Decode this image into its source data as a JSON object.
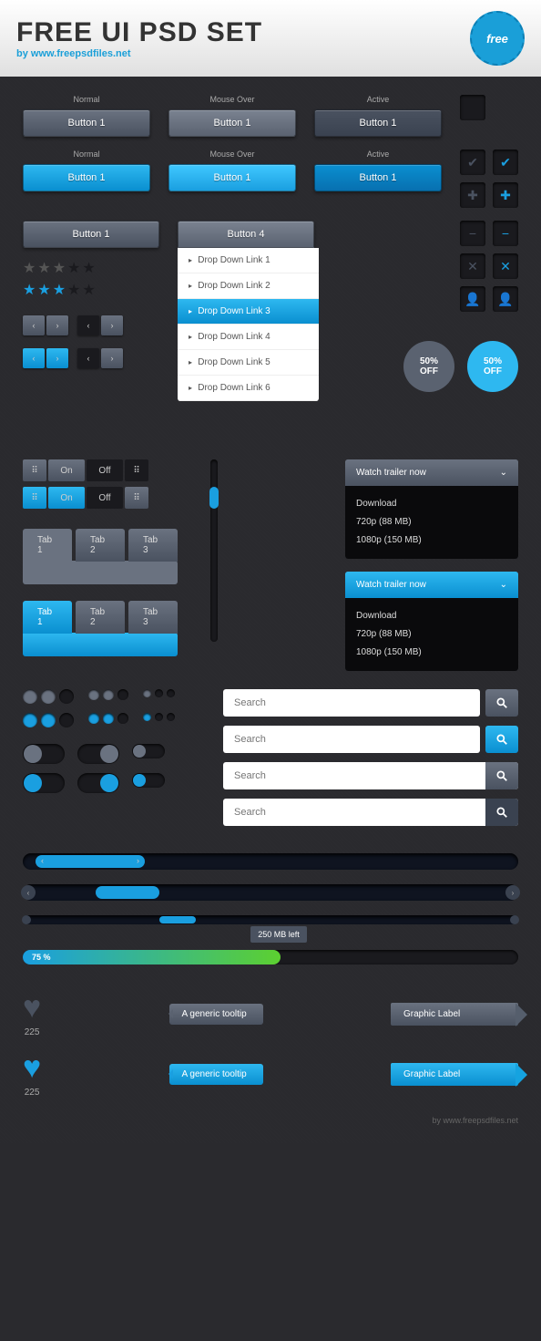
{
  "header": {
    "title": "FREE UI PSD SET",
    "byline": "by www.freepsdfiles.net",
    "badge": "free"
  },
  "states": {
    "normal": "Normal",
    "hover": "Mouse Over",
    "active": "Active"
  },
  "buttons": {
    "gray": "Button 1",
    "blue": "Button 1",
    "wide1": "Button 1",
    "wide4": "Button 4"
  },
  "dropdown": [
    "Drop Down Link 1",
    "Drop Down Link 2",
    "Drop Down Link 3",
    "Drop Down Link 4",
    "Drop Down Link 5",
    "Drop Down Link 6"
  ],
  "sale": {
    "pct": "50%",
    "off": "OFF"
  },
  "toggle": {
    "on": "On",
    "off": "Off"
  },
  "tabs": [
    "Tab 1",
    "Tab 2",
    "Tab 3"
  ],
  "trailer": {
    "title": "Watch trailer now",
    "dl": "Download",
    "q1": "720p (88 MB)",
    "q2": "1080p (150 MB)"
  },
  "search": {
    "placeholder": "Search"
  },
  "progress": {
    "pct": "75 %",
    "tip": "250 MB left"
  },
  "heart": {
    "count": "225"
  },
  "tooltip": "A generic tooltip",
  "label": "Graphic Label",
  "footer": "by www.freepsdfiles.net"
}
